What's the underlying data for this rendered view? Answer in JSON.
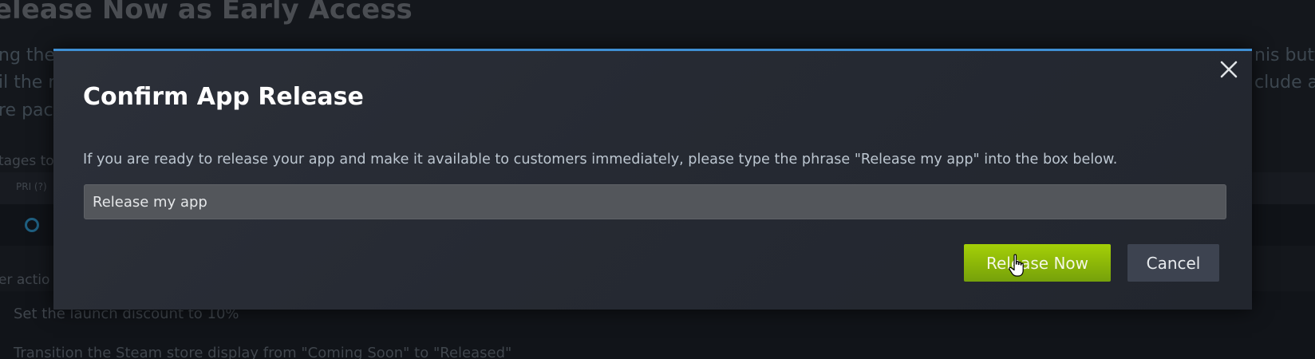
{
  "background": {
    "page_title": "elease Now as Early Access",
    "para_line1_left": "ng the",
    "para_line1_right": "nis butto",
    "para_line2_left": "il the n",
    "para_line2_right": "clude a",
    "para_line3_left": "re pac",
    "stages_label": "tages to",
    "pri_label": "PRI (?)",
    "other_actions_label": "er actio",
    "action_1": "Set the launch discount to 10%",
    "action_2": "Transition the Steam store display from \"Coming Soon\" to \"Released\""
  },
  "modal": {
    "close_icon": "close-icon",
    "title": "Confirm App Release",
    "description": "If you are ready to release your app and make it available to customers immediately, please type the phrase \"Release my app\" into the box below.",
    "input_value": "Release my app",
    "release_button_label": "Release Now",
    "cancel_button_label": "Cancel"
  },
  "colors": {
    "accent": "#3f8fd3",
    "release_button": "#a4d007",
    "cancel_button": "#3d4350"
  }
}
